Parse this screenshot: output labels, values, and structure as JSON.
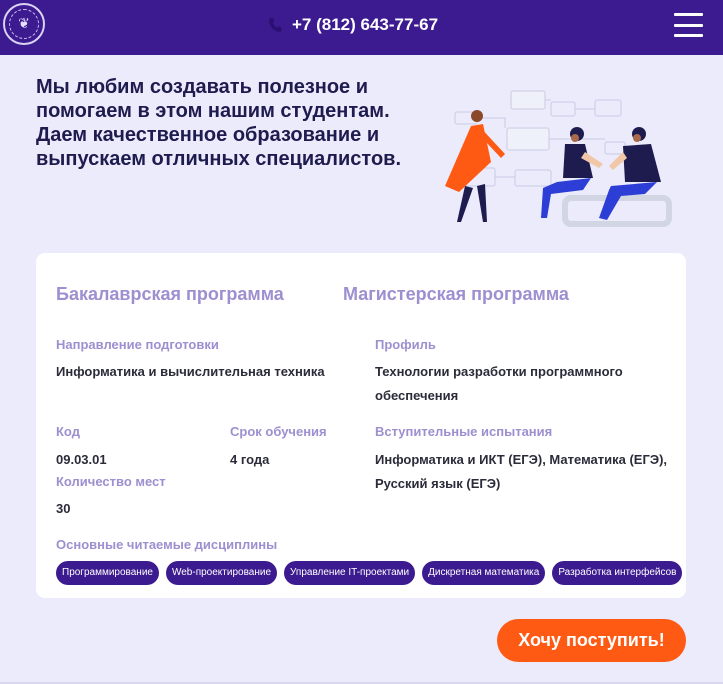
{
  "header": {
    "logo": "university-emblem",
    "phone": "+7 (812) 643-77-67"
  },
  "hero": {
    "text": "Мы любим создавать полезное и помогаем в этом нашим студентам. Даем качественное образование и выпускаем отличных специалистов."
  },
  "program": {
    "tabs": [
      "Бакалаврская программа",
      "Магистерская программа"
    ],
    "direction_label": "Направление подготовки",
    "direction_value": "Информатика и вычислительная техника",
    "profile_label": "Профиль",
    "profile_value": "Технологии разработки программного обеспечения",
    "code_label": "Код",
    "code_value": "09.03.01",
    "duration_label": "Срок обучения",
    "duration_value": "4 года",
    "exams_label": "Вступительные испытания",
    "exams_value": "Информатика и ИКТ (ЕГЭ), Математика (ЕГЭ), Русский язык (ЕГЭ)",
    "seats_label": "Количество мест",
    "seats_value": "30",
    "disciplines_label": "Основные читаемые дисциплины",
    "disciplines": [
      "Программирование",
      "Web-проектирование",
      "Управление IT-проектами",
      "Дискретная математика",
      "Разработка интерфейсов"
    ]
  },
  "cta": {
    "label": "Хочу поступить!"
  },
  "colors": {
    "header_bg": "#3c1a8f",
    "page_bg": "#ebebfb",
    "accent": "#ff5a14",
    "label": "#9d8fd0"
  }
}
